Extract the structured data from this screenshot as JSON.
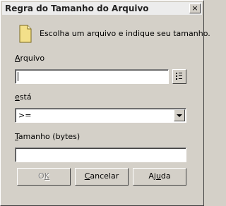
{
  "window": {
    "title": "Regra do Tamanho do Arquivo",
    "close_label": "×"
  },
  "intro": {
    "text": "Escolha um arquivo e indique seu tamanho.",
    "icon": "file-icon"
  },
  "file": {
    "label": "Arquivo",
    "value": ""
  },
  "operator": {
    "label": "está",
    "selected": ">="
  },
  "size": {
    "label": "Tamanho (bytes)",
    "value": ""
  },
  "buttons": {
    "ok": "OK",
    "cancel": "Cancelar",
    "help": "Ajuda"
  }
}
